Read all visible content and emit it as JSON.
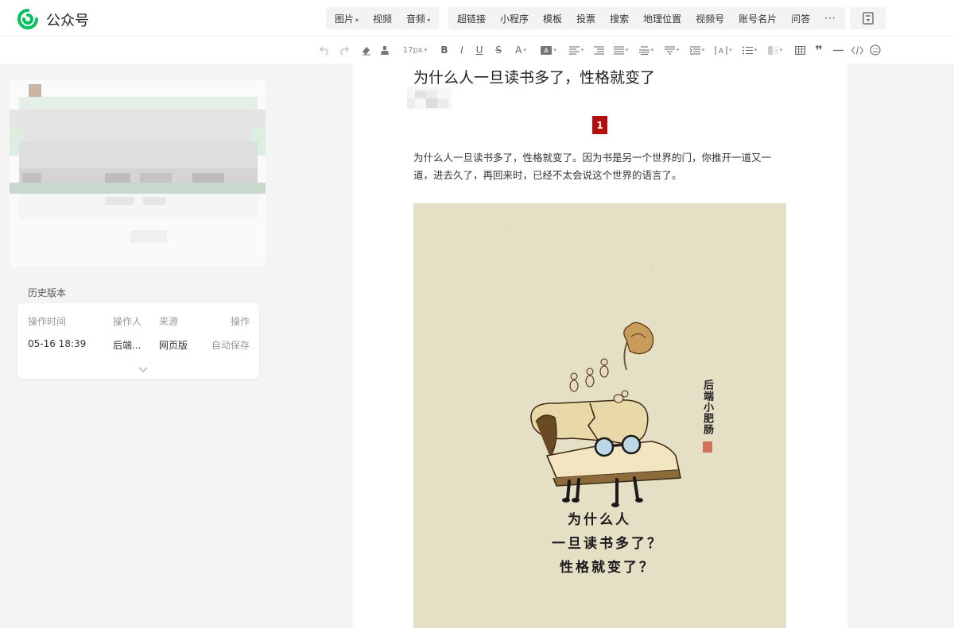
{
  "app": {
    "name": "公众号"
  },
  "insert_toolbar": {
    "group1": [
      {
        "label": "图片",
        "caret": true
      },
      {
        "label": "视频",
        "caret": false
      },
      {
        "label": "音频",
        "caret": true
      }
    ],
    "group2": [
      "超链接",
      "小程序",
      "模板",
      "投票",
      "搜索",
      "地理位置",
      "视频号",
      "账号名片",
      "问答"
    ],
    "more": "···"
  },
  "format_toolbar": {
    "font_size": "17px"
  },
  "history": {
    "title": "历史版本",
    "headers": {
      "time": "操作时间",
      "operator": "操作人",
      "source": "来源",
      "action": "操作"
    },
    "rows": [
      {
        "time": "05-16 18:39",
        "operator": "后端...",
        "source": "网页版",
        "action": "自动保存"
      }
    ]
  },
  "article": {
    "title": "为什么人一旦读书多了，性格就变了",
    "section_number": "1",
    "paragraph": "为什么人一旦读书多了，性格就变了。因为书是另一个世界的门，你推开一道又一道，进去久了，再回来时，已经不太会说这个世界的语言了。",
    "poster": {
      "lines": [
        "为什么人",
        "一旦读书多了？",
        "性格就变了？"
      ],
      "signature": "后端小肥肠"
    }
  },
  "colors": {
    "brand_green": "#07c160",
    "badge_red": "#b30f0f",
    "poster_bg": "#e5dfc6"
  }
}
